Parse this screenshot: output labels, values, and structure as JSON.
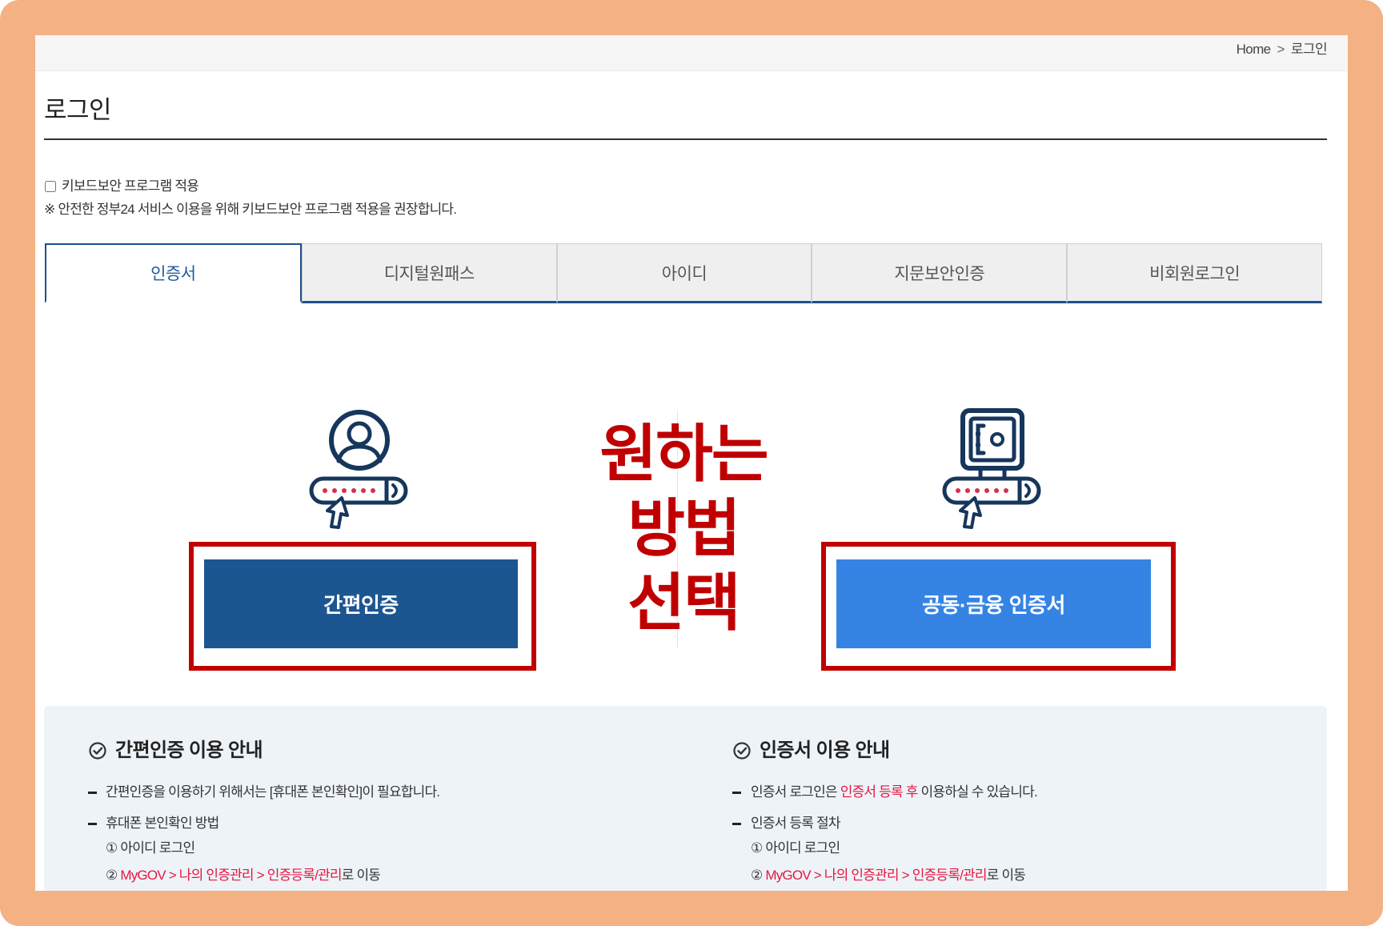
{
  "breadcrumb": {
    "home": "Home",
    "separator": ">",
    "current": "로그인"
  },
  "page": {
    "title": "로그인"
  },
  "security": {
    "checkbox_label": "키보드보안 프로그램 적용",
    "checked": false,
    "note": "※ 안전한 정부24 서비스 이용을 위해 키보드보안 프로그램 적용을 권장합니다."
  },
  "tabs": [
    {
      "label": "인증서",
      "active": true
    },
    {
      "label": "디지털원패스",
      "active": false
    },
    {
      "label": "아이디",
      "active": false
    },
    {
      "label": "지문보안인증",
      "active": false
    },
    {
      "label": "비회원로그인",
      "active": false
    }
  ],
  "methods": {
    "simple": {
      "button_label": "간편인증",
      "icon": "person-password-icon"
    },
    "cert": {
      "button_label": "공동·금융 인증서",
      "icon": "safe-password-icon"
    }
  },
  "annotation": {
    "lines": [
      "원하는",
      "방법",
      "선택"
    ]
  },
  "guide": {
    "simple": {
      "title": "간편인증 이용 안내",
      "item1": "간편인증을 이용하기 위해서는 [휴대폰 본인확인]이 필요합니다.",
      "item2": "휴대폰 본인확인 방법",
      "step1": "① 아이디 로그인",
      "step2_prefix": "② ",
      "step2_link": "MyGOV > 나의 인증관리 > 인증등록/관리",
      "step2_suffix": "로 이동"
    },
    "cert": {
      "title": "인증서 이용 안내",
      "item1_prefix": "인증서 로그인은 ",
      "item1_highlight": "인증서 등록 후",
      "item1_suffix": " 이용하실 수 있습니다.",
      "item2": "인증서 등록 절차",
      "step1": "① 아이디 로그인",
      "step2_prefix": "② ",
      "step2_link": "MyGOV > 나의 인증관리 > 인증등록/관리",
      "step2_suffix": "로 이동"
    }
  },
  "icons": {
    "guide_heading": "check-circle-icon",
    "breadcrumb_separator": "chevron-right-icon"
  },
  "colors": {
    "frame": "#F4B183",
    "accent": "#1E5B9B",
    "simple_button": "#1C5690",
    "cert_button": "#3584E4",
    "annotation": "#C00000",
    "link": "#E5173F"
  }
}
